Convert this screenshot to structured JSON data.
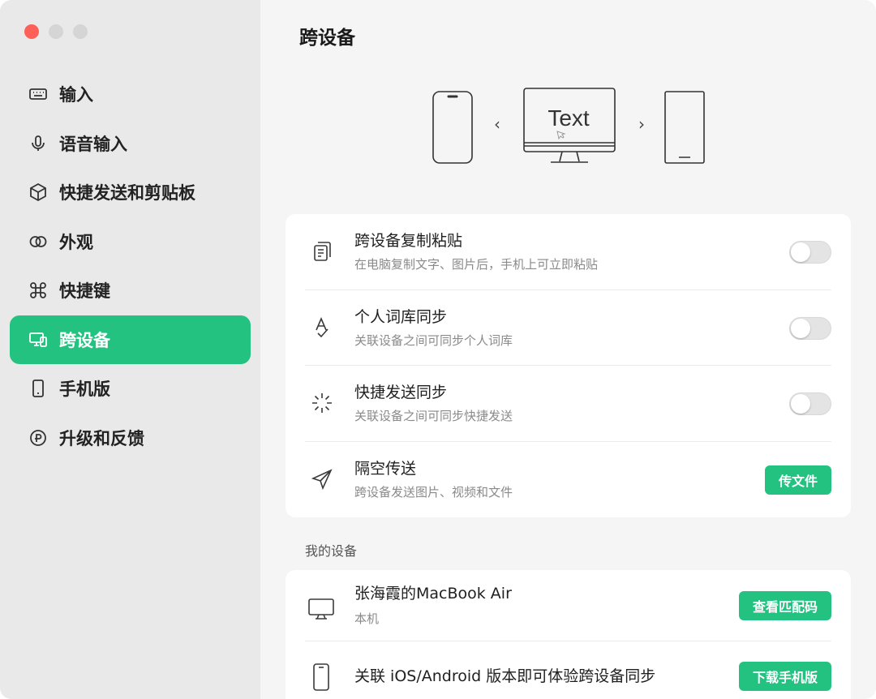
{
  "window": {
    "traffic_lights": [
      "close",
      "minimize",
      "maximize"
    ]
  },
  "sidebar": {
    "items": [
      {
        "label": "输入",
        "icon": "keyboard-icon",
        "active": false
      },
      {
        "label": "语音输入",
        "icon": "microphone-icon",
        "active": false
      },
      {
        "label": "快捷发送和剪贴板",
        "icon": "cube-icon",
        "active": false
      },
      {
        "label": "外观",
        "icon": "rings-icon",
        "active": false
      },
      {
        "label": "快捷键",
        "icon": "command-icon",
        "active": false
      },
      {
        "label": "跨设备",
        "icon": "devices-icon",
        "active": true
      },
      {
        "label": "手机版",
        "icon": "phone-icon",
        "active": false
      },
      {
        "label": "升级和反馈",
        "icon": "upgrade-icon",
        "active": false
      }
    ]
  },
  "main": {
    "title": "跨设备",
    "illustration": {
      "screen_text": "Text",
      "left_arrow": "‹",
      "right_arrow": "›"
    },
    "features": [
      {
        "title": "跨设备复制粘贴",
        "desc": "在电脑复制文字、图片后，手机上可立即粘贴",
        "icon": "clipboard-icon",
        "control": "toggle",
        "on": false
      },
      {
        "title": "个人词库同步",
        "desc": "关联设备之间可同步个人词库",
        "icon": "dictionary-icon",
        "control": "toggle",
        "on": false
      },
      {
        "title": "快捷发送同步",
        "desc": "关联设备之间可同步快捷发送",
        "icon": "sparkle-icon",
        "control": "toggle",
        "on": false
      },
      {
        "title": "隔空传送",
        "desc": "跨设备发送图片、视频和文件",
        "icon": "send-icon",
        "control": "button",
        "button_label": "传文件"
      }
    ],
    "my_devices_label": "我的设备",
    "devices": [
      {
        "title": "张海霞的MacBook Air",
        "desc": "本机",
        "icon": "monitor-icon",
        "button_label": "查看匹配码"
      },
      {
        "title": "关联 iOS/Android 版本即可体验跨设备同步",
        "desc": "",
        "icon": "phone-icon",
        "button_label": "下载手机版"
      }
    ]
  },
  "colors": {
    "accent": "#23c281",
    "sidebar_bg": "#e9e9e9",
    "main_bg": "#f5f5f5",
    "close": "#fe5f57"
  }
}
